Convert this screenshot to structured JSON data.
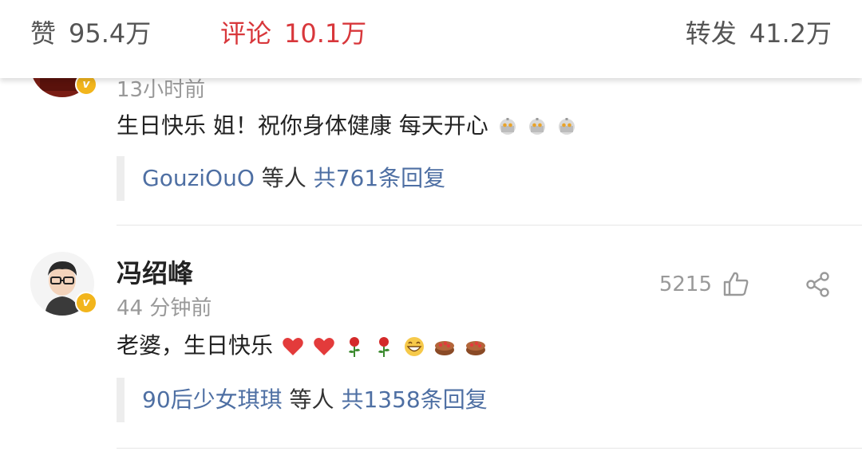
{
  "stats": {
    "likes": {
      "label": "赞",
      "value": "95.4万"
    },
    "comments": {
      "label": "评论",
      "value": "10.1万"
    },
    "reposts": {
      "label": "转发",
      "value": "41.2万"
    }
  },
  "comments": [
    {
      "time": "13小时前",
      "text": "生日快乐 姐！祝你身体健康 每天开心",
      "emojis": [
        "doge-icon",
        "doge-icon",
        "doge-icon"
      ],
      "reply": {
        "users": "GouziOuO",
        "mid": " 等人 ",
        "count": "共761条回复"
      }
    },
    {
      "username": "冯绍峰",
      "time": "44 分钟前",
      "like_count": "5215",
      "text": "老婆，生日快乐",
      "emojis": [
        "heart-icon",
        "heart-icon",
        "rose-icon",
        "rose-icon",
        "grin-icon",
        "cake-icon",
        "cake-icon"
      ],
      "reply": {
        "users": "90后少女琪琪",
        "mid": " 等人 ",
        "count": "共1358条回复"
      }
    }
  ],
  "colors": {
    "accent_red": "#d8373b",
    "link_blue": "#4e6fa3",
    "verified_gold": "#f2b51c"
  }
}
